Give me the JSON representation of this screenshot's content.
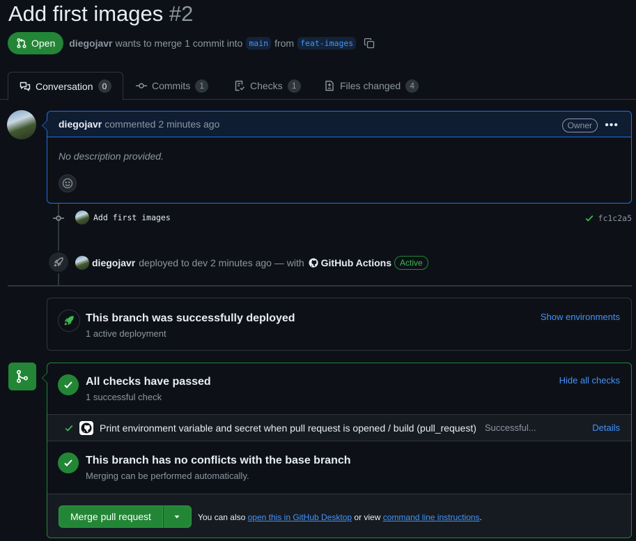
{
  "pr": {
    "title": "Add first images",
    "number": "#2",
    "state": "Open",
    "author": "diegojavr",
    "summary_mid": "wants to merge 1 commit into",
    "base_branch": "main",
    "from_word": "from",
    "head_branch": "feat-images"
  },
  "tabs": [
    {
      "label": "Conversation",
      "count": "0",
      "icon": "comment-discussion-icon"
    },
    {
      "label": "Commits",
      "count": "1",
      "icon": "git-commit-icon"
    },
    {
      "label": "Checks",
      "count": "1",
      "icon": "checklist-icon"
    },
    {
      "label": "Files changed",
      "count": "4",
      "icon": "file-diff-icon"
    }
  ],
  "comment": {
    "author": "diegojavr",
    "action": "commented",
    "time": "2 minutes ago",
    "role": "Owner",
    "body": "No description provided."
  },
  "commit_event": {
    "message": "Add first images",
    "sha": "fc1c2a5"
  },
  "deploy_event": {
    "user": "diegojavr",
    "text": "deployed to dev 2 minutes ago — with",
    "app": "GitHub Actions",
    "badge": "Active"
  },
  "deployment_box": {
    "title": "This branch was successfully deployed",
    "subtitle": "1 active deployment",
    "link": "Show environments"
  },
  "checks": {
    "title": "All checks have passed",
    "subtitle": "1 successful check",
    "toggle_link": "Hide all checks",
    "items": [
      {
        "name": "Print environment variable and secret when pull request is opened / build (pull_request)",
        "status": "Successful...",
        "details": "Details"
      }
    ]
  },
  "conflicts": {
    "title": "This branch has no conflicts with the base branch",
    "subtitle": "Merging can be performed automatically."
  },
  "merge": {
    "button": "Merge pull request",
    "also_prefix": "You can also",
    "desktop_link": "open this in GitHub Desktop",
    "or_view": "or view",
    "cli_link": "command line instructions",
    "suffix": "."
  },
  "colors": {
    "accent_green": "#238636",
    "link_blue": "#4493f8",
    "background": "#0d1117"
  }
}
